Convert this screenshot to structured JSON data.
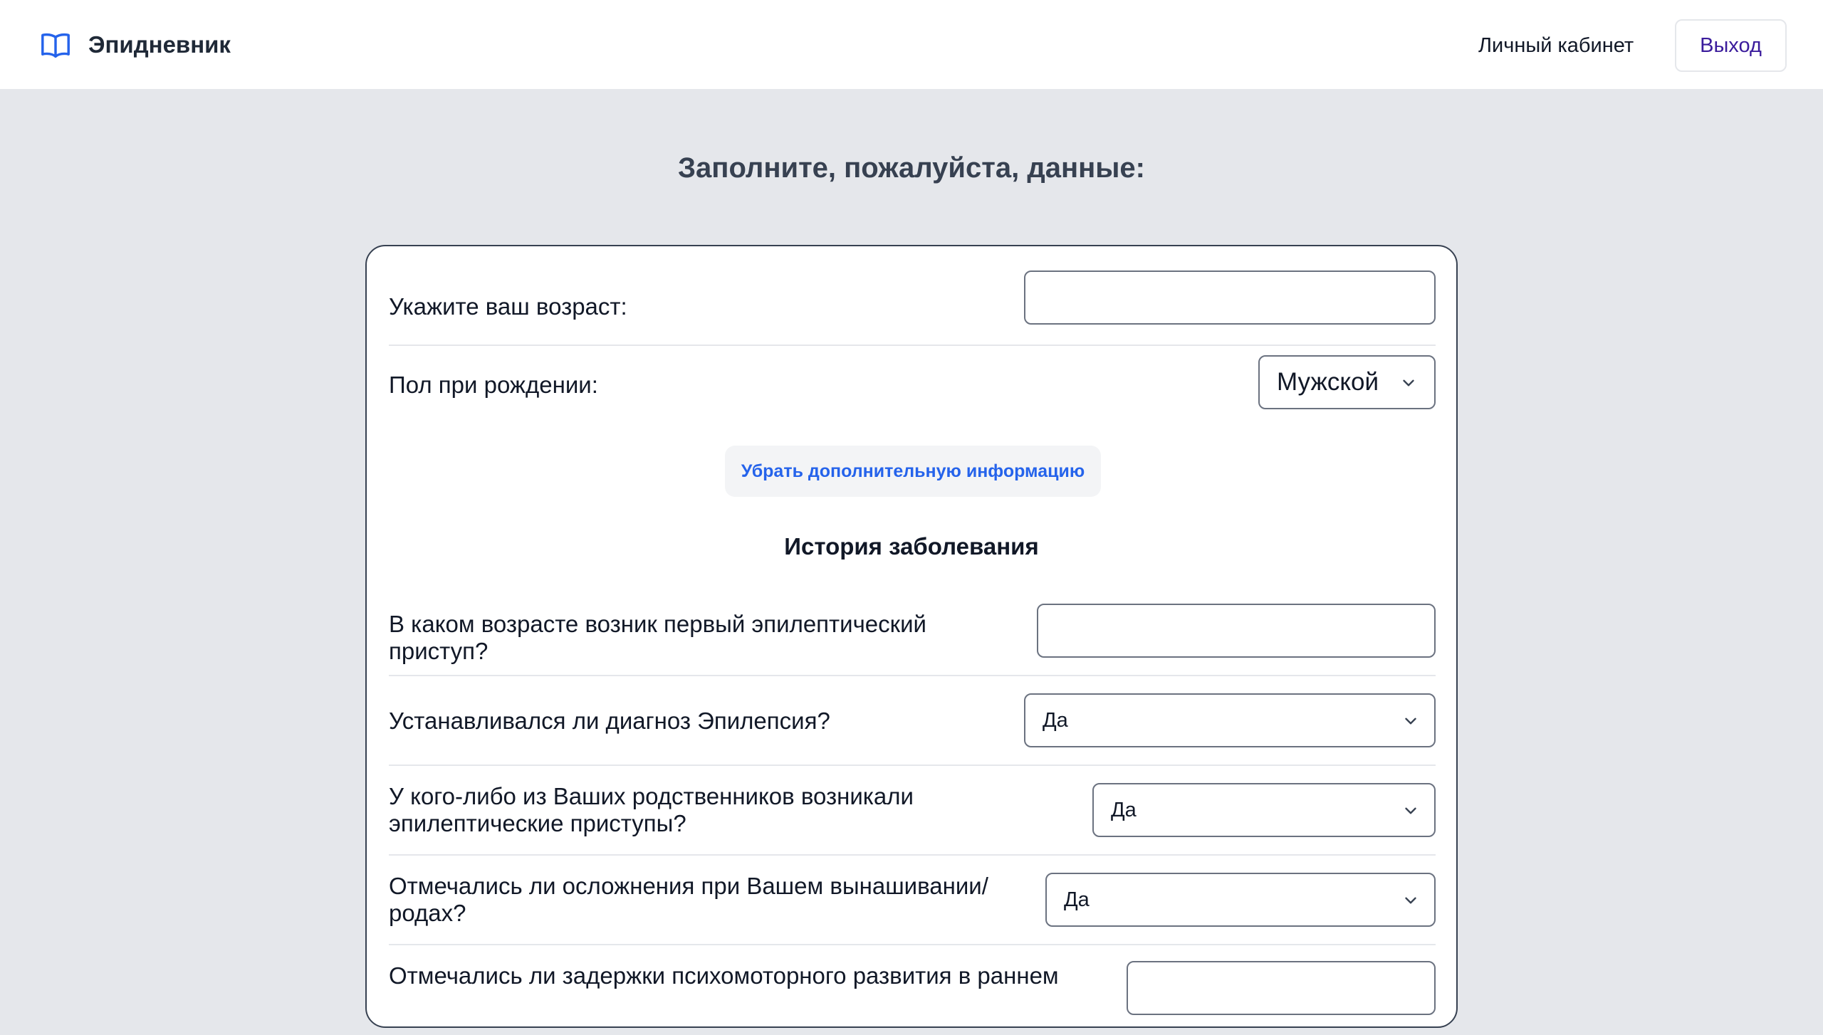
{
  "app": {
    "brand_name": "Эпидневник",
    "brand_icon": "open-book-icon",
    "accent_color": "#2563eb"
  },
  "nav": {
    "cabinet_label": "Личный кабинет",
    "logout_label": "Выход"
  },
  "page": {
    "heading": "Заполните, пожалуйста, данные:"
  },
  "form": {
    "age": {
      "label": "Укажите ваш возраст:",
      "value": ""
    },
    "sex": {
      "label": "Пол при рождении:",
      "value": "Мужской"
    },
    "toggle_label": "Убрать дополнительную информацию",
    "section_title": "История заболевания",
    "first_seizure_age": {
      "label": "В каком возрасте возник первый эпилептический приступ?",
      "value": ""
    },
    "epilepsy_diagnosis": {
      "label": "Устанавливался ли диагноз Эпилепсия?",
      "value": "Да"
    },
    "relatives_seizures": {
      "label": "У кого-либо из Ваших родственников возникали эпилептические приступы?",
      "value": "Да"
    },
    "pregnancy_complications": {
      "label": "Отмечались ли осложнения при Вашем вынашивании/ родах?",
      "value": "Да"
    },
    "psychomotor_delay": {
      "label": "Отмечались ли задержки психомоторного развития в раннем"
    }
  }
}
